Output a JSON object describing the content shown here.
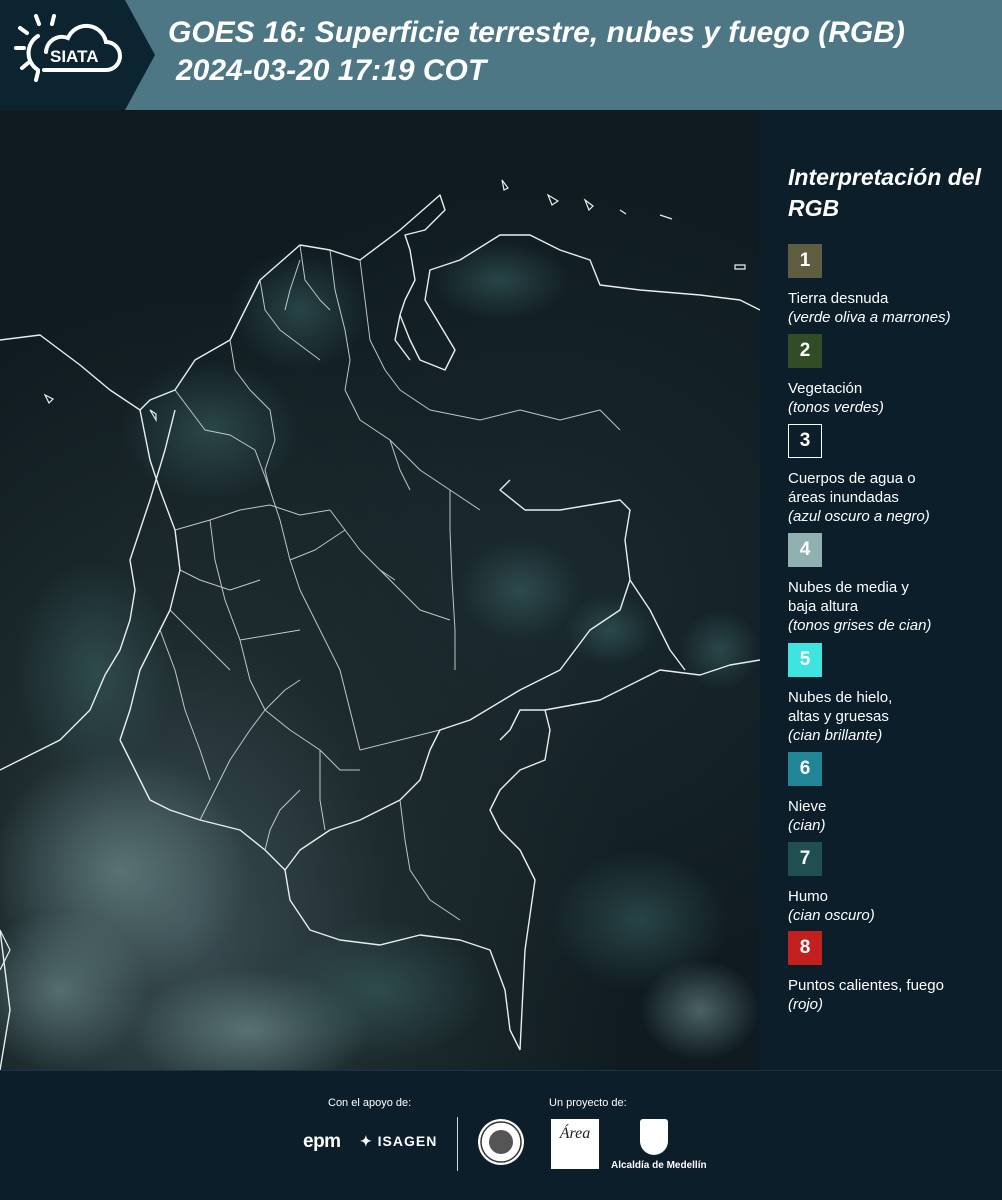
{
  "header": {
    "logo_text": "SIATA",
    "title_line1": "GOES 16: Superficie terrestre, nubes y fuego (RGB)",
    "title_line2": "2024-03-20 17:19 COT"
  },
  "legend": {
    "title": "Interpretación del RGB",
    "items": [
      {
        "number": "1",
        "label": "Tierra desnuda",
        "sub": "(verde oliva a marrones)",
        "color": "#5f5d40"
      },
      {
        "number": "2",
        "label": "Vegetación",
        "sub": "(tonos verdes)",
        "color": "#324d25"
      },
      {
        "number": "3",
        "label": "Cuerpos de agua o áreas inundadas",
        "sub": "(azul oscuro a negro)",
        "color": "#0b1e2a"
      },
      {
        "number": "4",
        "label": "Nubes de media y baja altura",
        "sub": "(tonos grises de cian)",
        "color": "#8fb2b1"
      },
      {
        "number": "5",
        "label": "Nubes de hielo, altas y gruesas",
        "sub": "(cian brillante)",
        "color": "#3fe3e0"
      },
      {
        "number": "6",
        "label": "Nieve",
        "sub": "(cian)",
        "color": "#1f8597"
      },
      {
        "number": "7",
        "label": "Humo",
        "sub": "(cian oscuro)",
        "color": "#1f4f50"
      },
      {
        "number": "8",
        "label": "Puntos calientes, fuego",
        "sub": "(rojo)",
        "color": "#c21f1f"
      }
    ]
  },
  "footer": {
    "support_label": "Con el apoyo de:",
    "project_label": "Un proyecto de:",
    "epm": "epm",
    "isagen": "ISAGEN",
    "area_mark": "Área",
    "alcaldia": "Alcaldía de Medellín"
  }
}
